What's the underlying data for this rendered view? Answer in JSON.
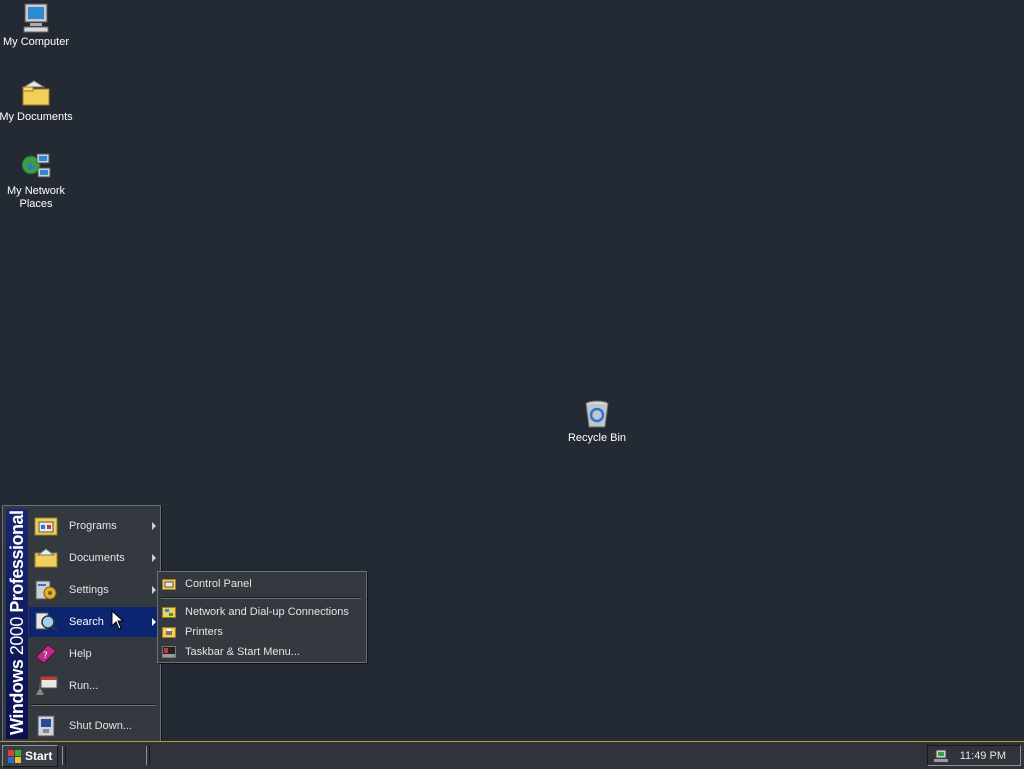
{
  "desktop": {
    "icons": [
      {
        "label": "My Computer",
        "icon": "computer-icon"
      },
      {
        "label": "My Documents",
        "icon": "folder-documents-icon"
      },
      {
        "label": "My Network Places",
        "icon": "network-places-icon"
      },
      {
        "label": "Recycle Bin",
        "icon": "recycle-bin-icon"
      }
    ]
  },
  "start_menu": {
    "banner_bold": "Windows",
    "banner_normal": "2000",
    "banner_edition": "Professional",
    "items": [
      {
        "label": "Programs",
        "has_submenu": true,
        "icon": "programs-icon"
      },
      {
        "label": "Documents",
        "has_submenu": true,
        "icon": "documents-icon"
      },
      {
        "label": "Settings",
        "has_submenu": true,
        "icon": "settings-icon"
      },
      {
        "label": "Search",
        "has_submenu": true,
        "icon": "search-icon",
        "highlighted": true
      },
      {
        "label": "Help",
        "has_submenu": false,
        "icon": "help-icon"
      },
      {
        "label": "Run...",
        "has_submenu": false,
        "icon": "run-icon"
      },
      {
        "label": "Shut Down...",
        "has_submenu": false,
        "icon": "shutdown-icon"
      }
    ]
  },
  "settings_submenu": {
    "items": [
      {
        "label": "Control Panel",
        "icon": "control-panel-icon"
      },
      {
        "label": "Network and Dial-up Connections",
        "icon": "network-connections-icon"
      },
      {
        "label": "Printers",
        "icon": "printers-icon"
      },
      {
        "label": "Taskbar & Start Menu...",
        "icon": "taskbar-settings-icon"
      }
    ]
  },
  "taskbar": {
    "start_label": "Start",
    "clock": "11:49 PM"
  },
  "colors": {
    "desktop": "#242a33",
    "highlight": "#0b2570",
    "taskbar_border": "#b89a3e"
  }
}
